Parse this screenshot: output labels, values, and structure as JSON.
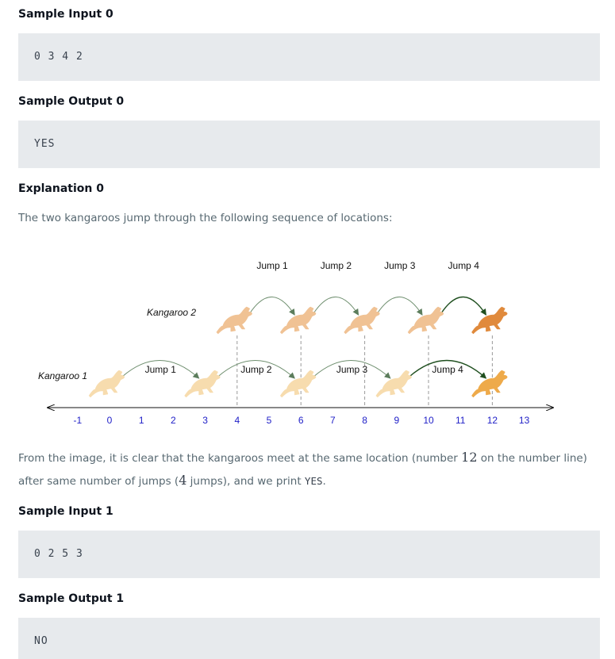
{
  "sample_input_0": {
    "heading": "Sample Input 0",
    "code": "0 3 4 2"
  },
  "sample_output_0": {
    "heading": "Sample Output 0",
    "code": "YES"
  },
  "explanation_0": {
    "heading": "Explanation 0",
    "intro": "The two kangaroos jump through the following sequence of locations:",
    "conclusion": {
      "part1": "From the image, it is clear that the kangaroos meet at the same location (number ",
      "meet_location": "12",
      "part2": " on the number line) after same number of jumps (",
      "jump_count": "4",
      "part3": " jumps), and we print ",
      "printed_value": "YES",
      "part4": "."
    }
  },
  "diagram": {
    "kangaroo1_label": "Kangaroo 1",
    "kangaroo2_label": "Kangaroo 2",
    "kangaroo1_jump_labels": [
      "Jump 1",
      "Jump 2",
      "Jump 3",
      "Jump 4"
    ],
    "kangaroo2_jump_labels": [
      "Jump 1",
      "Jump 2",
      "Jump 3",
      "Jump 4"
    ],
    "tick_labels": [
      "-1",
      "0",
      "1",
      "2",
      "3",
      "4",
      "5",
      "6",
      "7",
      "8",
      "9",
      "10",
      "11",
      "12",
      "13"
    ],
    "kangaroo1_positions": [
      0,
      3,
      6,
      9,
      12
    ],
    "kangaroo2_positions": [
      4,
      6,
      8,
      10,
      12
    ],
    "colors": {
      "tick_label": "#2121c8",
      "kangaroo1": "#f7dcae",
      "kangaroo1_final": "#eeaa4a",
      "kangaroo2": "#f0c294",
      "kangaroo2_final": "#e08a3c",
      "arrow_start": "#6f8f6f",
      "arrow_end": "#1f4f1f"
    }
  },
  "sample_input_1": {
    "heading": "Sample Input 1",
    "code": "0 2 5 3"
  },
  "sample_output_1": {
    "heading": "Sample Output 1",
    "code": "NO"
  }
}
